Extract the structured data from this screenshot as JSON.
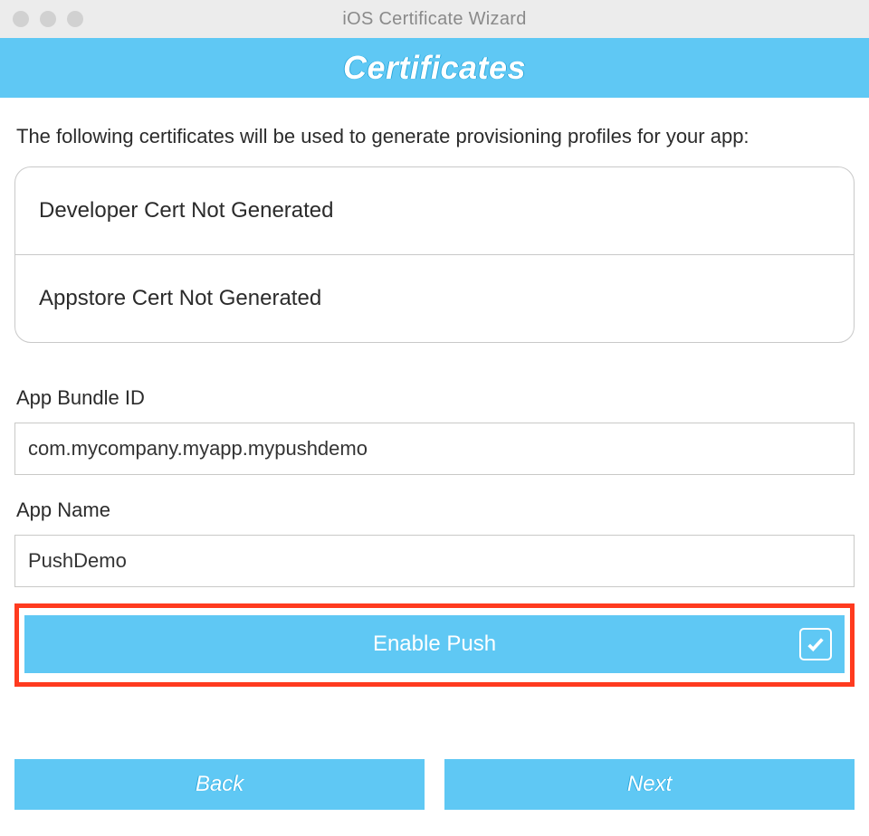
{
  "window": {
    "title": "iOS Certificate Wizard"
  },
  "header": {
    "band_title": "Certificates"
  },
  "intro": "The following certificates will be used to generate provisioning profiles for your app:",
  "certs": {
    "developer": "Developer Cert Not Generated",
    "appstore": "Appstore Cert Not Generated"
  },
  "fields": {
    "bundle_id_label": "App Bundle ID",
    "bundle_id_value": "com.mycompany.myapp.mypushdemo",
    "app_name_label": "App Name",
    "app_name_value": "PushDemo"
  },
  "enable_push": {
    "label": "Enable Push",
    "checked": true
  },
  "nav": {
    "back": "Back",
    "next": "Next"
  },
  "colors": {
    "accent": "#5fc8f4",
    "highlight_border": "#ff3b1f"
  }
}
